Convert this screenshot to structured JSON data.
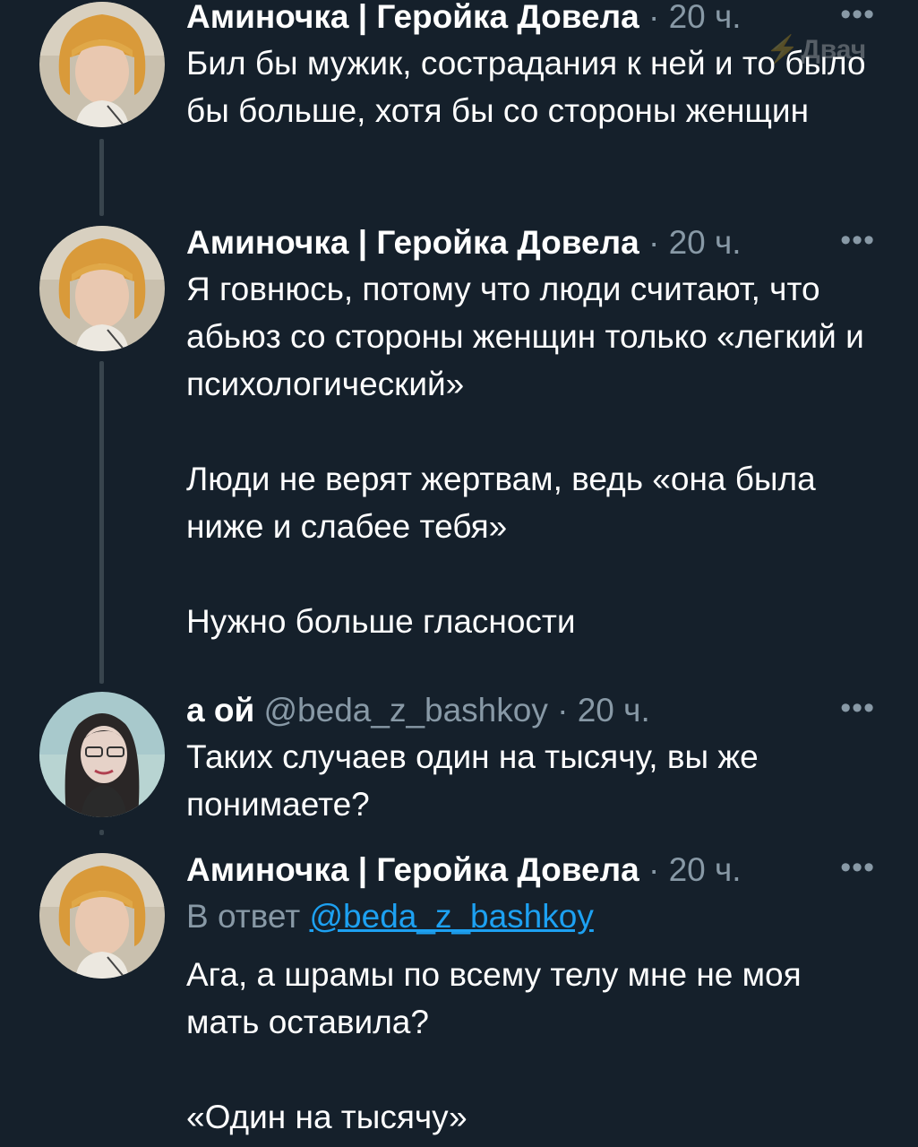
{
  "watermark": {
    "label": "Двач",
    "icon": "lightning-icon"
  },
  "tweets": [
    {
      "author": "Аминочка | Геройка Довела",
      "handle": "",
      "separator": "·",
      "time": "20 ч.",
      "more": "•••",
      "text": "Бил бы мужик, сострадания к ней и то было бы больше, хотя бы со стороны женщин",
      "avatar": "avatar-aminochka"
    },
    {
      "author": "Аминочка | Геройка Довела",
      "handle": "",
      "separator": "·",
      "time": "20 ч.",
      "more": "•••",
      "text": "Я говнюсь, потому что люди считают, что абьюз со стороны женщин только «легкий и психологический»\n\nЛюди не верят жертвам, ведь «она была ниже и слабее тебя»\n\nНужно больше гласности",
      "avatar": "avatar-aminochka"
    },
    {
      "author": "а ой",
      "handle": "@beda_z_bashkoy",
      "separator": "·",
      "time": "20 ч.",
      "more": "•••",
      "text": "Таких случаев один на тысячу, вы же понимаете?",
      "avatar": "avatar-a-oy"
    },
    {
      "author": "Аминочка | Геройка Довела",
      "handle": "",
      "separator": "·",
      "time": "20 ч.",
      "more": "•••",
      "reply_prefix": "В ответ",
      "reply_mention": "@beda_z_bashkoy",
      "text": "Ага, а шрамы по всему телу мне не моя мать оставила?\n\n«Один на тысячу»",
      "avatar": "avatar-aminochka"
    }
  ],
  "colors": {
    "background": "#15202b",
    "secondary_text": "#8899a6",
    "link": "#1da1f2",
    "thread_line": "#38444d"
  }
}
